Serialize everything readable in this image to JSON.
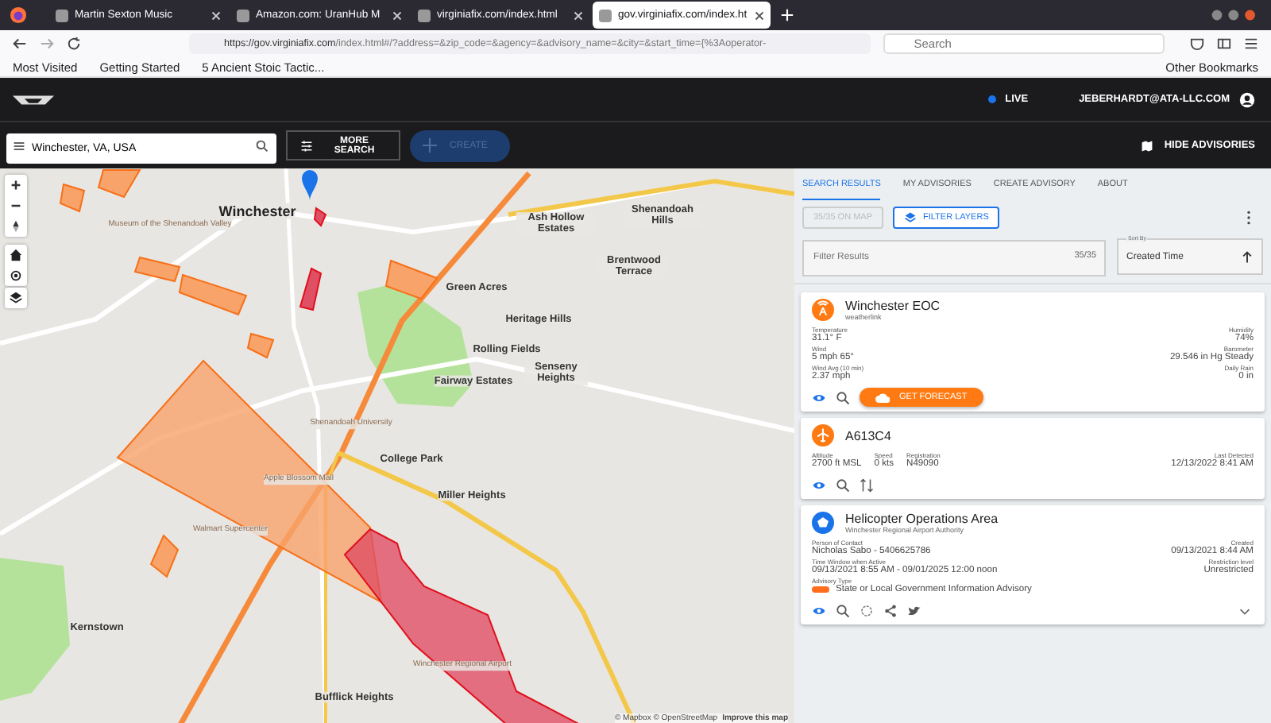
{
  "browser": {
    "tabs": [
      {
        "title": "Martin Sexton Music",
        "selected": false
      },
      {
        "title": "Amazon.com: UranHub M",
        "selected": false
      },
      {
        "title": "virginiafix.com/index.html",
        "selected": false
      },
      {
        "title": "gov.virginiafix.com/index.ht",
        "selected": true
      }
    ],
    "url_host": "https://gov.virginiafix.com",
    "url_path": "/index.html#/?address=&zip_code=&agency=&advisory_name=&city=&start_time={%3Aoperator-",
    "search_placeholder": "Search",
    "bookmarks": [
      "Most Visited",
      "Getting Started",
      "5 Ancient Stoic Tactic..."
    ],
    "other_bookmarks": "Other Bookmarks"
  },
  "header": {
    "live": "LIVE",
    "user": "JEBERHARDT@ATA-LLC.COM"
  },
  "toolbar": {
    "search_value": "Winchester, VA, USA",
    "more_search": "MORE SEARCH",
    "create": "CREATE",
    "create_disabled": true,
    "hide_advisories": "HIDE ADVISORIES"
  },
  "map": {
    "labels": [
      {
        "text": "Winchester",
        "kind": "town"
      },
      {
        "text": "Green Acres",
        "kind": "place"
      },
      {
        "text": "Heritage Hills",
        "kind": "place"
      },
      {
        "text": "Rolling Fields",
        "kind": "place"
      },
      {
        "text": "Fairway Estates",
        "kind": "place"
      },
      {
        "text": "Senseny Heights",
        "kind": "place"
      },
      {
        "text": "College Park",
        "kind": "place"
      },
      {
        "text": "Miller Heights",
        "kind": "place"
      },
      {
        "text": "Kernstown",
        "kind": "place"
      },
      {
        "text": "Bufflick Heights",
        "kind": "place"
      },
      {
        "text": "Ash Hollow Estates",
        "kind": "place"
      },
      {
        "text": "Shenandoah Hills",
        "kind": "place"
      },
      {
        "text": "Brentwood Terrace",
        "kind": "place"
      },
      {
        "text": "Museum of the Shenandoah Valley",
        "kind": "poi"
      },
      {
        "text": "Shenandoah University",
        "kind": "poi"
      },
      {
        "text": "Apple Blossom Mall",
        "kind": "poi"
      },
      {
        "text": "Walmart Supercenter",
        "kind": "poi"
      },
      {
        "text": "Winchester Regional Airport",
        "kind": "poi"
      }
    ],
    "attribution": "© Mapbox © OpenStreetMap",
    "improve": "Improve this map"
  },
  "panel": {
    "tabs": [
      {
        "label": "SEARCH RESULTS",
        "selected": true
      },
      {
        "label": "MY ADVISORIES",
        "selected": false
      },
      {
        "label": "CREATE ADVISORY",
        "selected": false
      },
      {
        "label": "ABOUT",
        "selected": false
      }
    ],
    "on_map": "35/35 ON MAP",
    "on_map_disabled": true,
    "filter_layers": "FILTER LAYERS",
    "filter": {
      "placeholder": "Filter Results",
      "count": "35/35"
    },
    "sort": {
      "label": "Sort By",
      "value": "Created Time"
    },
    "cards": [
      {
        "kind": "weather",
        "color": "#ff7a12",
        "title": "Winchester EOC",
        "subtitle": "weatherlink",
        "left": [
          {
            "label": "Temperature",
            "value": "31.1° F"
          },
          {
            "label": "Wind",
            "value": "5 mph 65°"
          },
          {
            "label": "Wind Avg (10 min)",
            "value": "2.37 mph"
          }
        ],
        "right": [
          {
            "label": "Humidity",
            "value": "74%"
          },
          {
            "label": "Barometer",
            "value": "29.546 in Hg Steady"
          },
          {
            "label": "Daily Rain",
            "value": "0 in"
          }
        ],
        "action": "GET FORECAST"
      },
      {
        "kind": "aircraft",
        "color": "#ff7a12",
        "title": "A613C4",
        "left": [
          {
            "label": "Altitude",
            "value": "2700 ft MSL"
          },
          {
            "label": "Speed",
            "value": "0 kts"
          },
          {
            "label": "Registration",
            "value": "N49090"
          }
        ],
        "right": [
          {
            "label": "Last Detected",
            "value": "12/13/2022 8:41 AM"
          }
        ]
      },
      {
        "kind": "advisory",
        "color": "#1a73e8",
        "title": "Helicopter Operations Area",
        "subtitle": "Winchester Regional Airport Authority",
        "left": [
          {
            "label": "Person of Contact",
            "value": "Nicholas Sabo - 5406625786"
          },
          {
            "label": "Time Window when Active",
            "value": "09/13/2021 8:55 AM - 09/01/2025 12:00 noon"
          }
        ],
        "right": [
          {
            "label": "Created",
            "value": "09/13/2021 8:44 AM"
          },
          {
            "label": "Restriction level",
            "value": "Unrestricted"
          }
        ],
        "type_label": "Advisory Type",
        "type": {
          "text": "State or Local Government Information Advisory",
          "color": "#ff6d1f"
        },
        "expanded": false
      }
    ]
  }
}
